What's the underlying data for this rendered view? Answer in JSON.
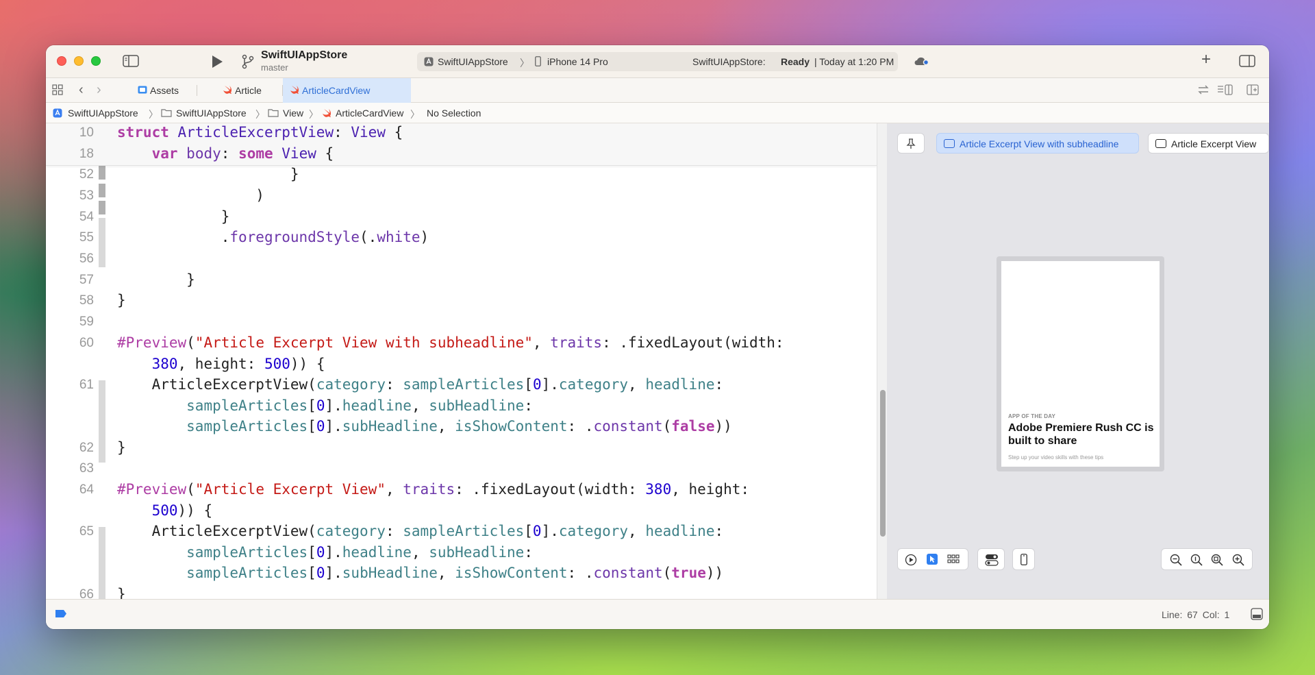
{
  "toolbar": {
    "project_name": "SwiftUIAppStore",
    "branch": "master",
    "scheme": "SwiftUIAppStore",
    "destination": "iPhone 14 Pro",
    "status_prefix": "SwiftUIAppStore:",
    "status_state": "Ready",
    "status_time": "| Today at 1:20 PM"
  },
  "tabs": [
    {
      "label": "Assets"
    },
    {
      "label": "Article"
    },
    {
      "label": "ArticleCardView"
    }
  ],
  "jumpbar": {
    "items": [
      "SwiftUIAppStore",
      "SwiftUIAppStore",
      "View",
      "ArticleCardView",
      "No Selection"
    ]
  },
  "editor": {
    "sticky_lines": [
      {
        "number": "10"
      },
      {
        "number": "18"
      }
    ],
    "line_numbers": [
      "52",
      "53",
      "54",
      "55",
      "56",
      "57",
      "58",
      "59",
      "60",
      "61",
      "62",
      "63",
      "64",
      "65",
      "66"
    ]
  },
  "preview": {
    "tabs": [
      {
        "label": "Article Excerpt View with subheadline"
      },
      {
        "label": "Article Excerpt View"
      }
    ],
    "card": {
      "category": "APP OF THE DAY",
      "headline": "Adobe Premiere Rush CC is built to share",
      "subheadline": "Step up your video skills with these tips"
    }
  },
  "statusbar": {
    "position": "Line: 67  Col: 1"
  },
  "colors": {
    "accent": "#2f6fd6",
    "keyword": "#ad3da4",
    "string": "#c41a16",
    "number": "#1c00cf"
  }
}
